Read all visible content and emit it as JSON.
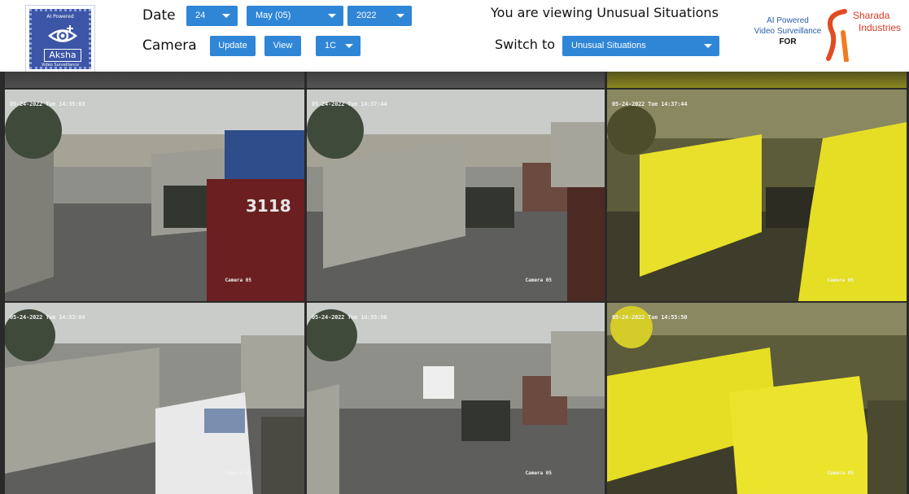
{
  "header": {
    "aksha_logo": {
      "top_text": "AI Powered",
      "name": "Aksha",
      "sub_text": "Video Surveillance"
    },
    "date_label": "Date",
    "camera_label": "Camera",
    "day_select": "24",
    "month_select": "May (05)",
    "year_select": "2022",
    "update_button": "Update",
    "view_button": "View",
    "camera_select": "1C",
    "viewing_text": "You are viewing Unusual Situations",
    "switch_label": "Switch to",
    "switch_select": "Unusual Situations",
    "ai_line1": "AI Powered",
    "ai_line2": "Video Surveillance",
    "ai_line3": "FOR",
    "sharada_line1": "Sharada",
    "sharada_line2": "Industries"
  },
  "feeds": {
    "row1": [
      {
        "timestamp": "05-24-2022 Tue 14:35:03",
        "camera": "Camera 05"
      },
      {
        "timestamp": "05-24-2022 Tue 14:37:44",
        "camera": "Camera 05"
      },
      {
        "timestamp": "05-24-2022 Tue 14:37:44",
        "camera": "Camera 05"
      }
    ],
    "row2": [
      {
        "timestamp": "05-24-2022 Tue 14:53:04",
        "camera": "Camera 05"
      },
      {
        "timestamp": "05-24-2022 Tue 14:55:50",
        "camera": "Camera 05"
      },
      {
        "timestamp": "05-24-2022 Tue 14:55:50",
        "camera": "Camera 05"
      }
    ]
  },
  "colors": {
    "accent": "#2f86d6",
    "logo_blue": "#3c55a6",
    "brand_red": "#d73a24",
    "highlight_yellow": "#ebe628"
  },
  "icons": {
    "aksha": "eye-icon",
    "sharada": "sharada-s-logo",
    "dropdown": "chevron-down-icon"
  }
}
